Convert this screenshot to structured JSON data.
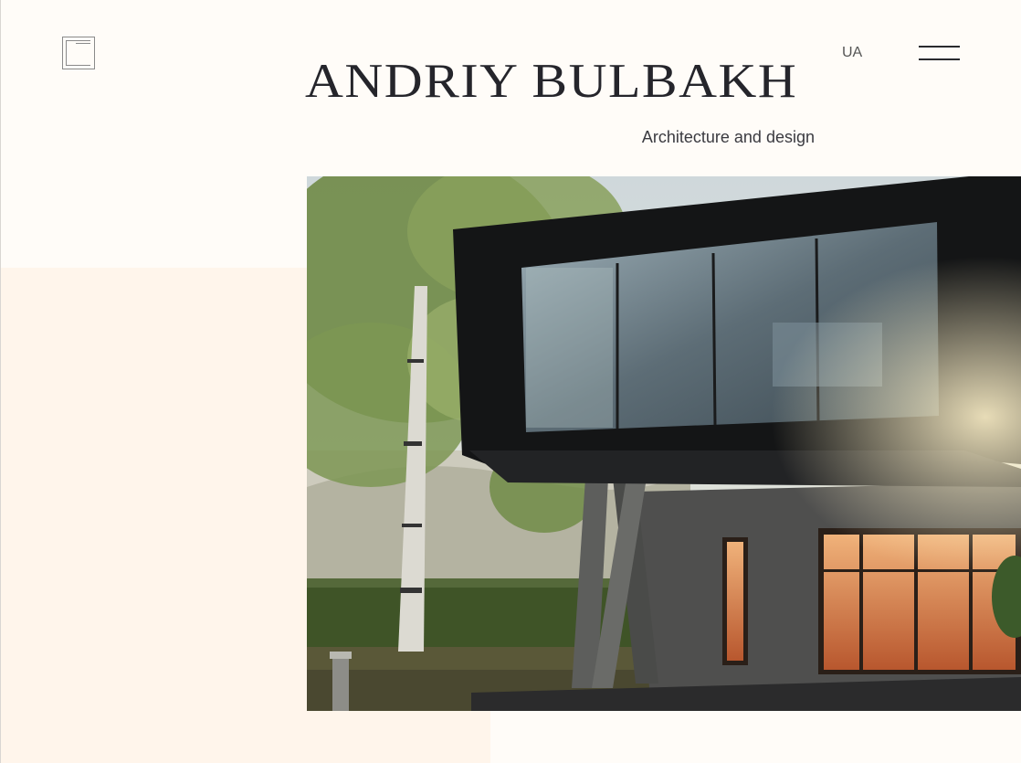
{
  "header": {
    "brand_name": "ANDRIY BULBAKH",
    "tagline": "Architecture and design",
    "language": "UA",
    "logo_icon": "square-frame-logo-icon",
    "menu_icon": "hamburger-menu-icon"
  },
  "hero": {
    "image": "modern-house-render"
  },
  "colors": {
    "page_background": "#fffcf8",
    "accent_panel": "#fff5eb",
    "text": "#25252b"
  }
}
